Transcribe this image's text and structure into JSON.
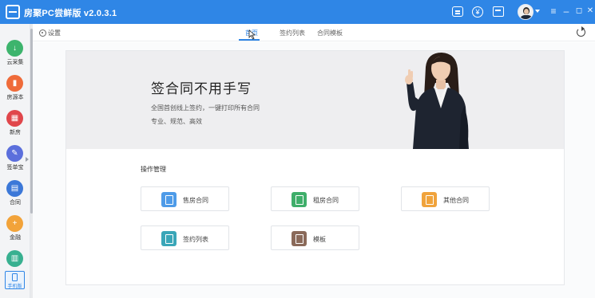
{
  "app": {
    "title": "房聚PC尝鲜版 v2.0.3.1"
  },
  "window_controls": {
    "menu": "≡",
    "minimize": "–",
    "maximize": "◻",
    "close": "✕"
  },
  "titlebar_icons": {
    "yen": "¥"
  },
  "sidebar": {
    "items": [
      {
        "label": "云采集",
        "color": "#3db46d",
        "icon": "download-icon",
        "glyph": "↓"
      },
      {
        "label": "房源本",
        "color": "#ef6b3a",
        "icon": "book-icon",
        "glyph": "▮"
      },
      {
        "label": "新房",
        "color": "#e0464b",
        "icon": "building-icon",
        "glyph": "▦"
      },
      {
        "label": "签单宝",
        "color": "#5b6fdc",
        "icon": "pen-icon",
        "glyph": "✎"
      },
      {
        "label": "合同",
        "color": "#3c78d8",
        "icon": "contract-icon",
        "glyph": "▤"
      },
      {
        "label": "金融",
        "color": "#f2a33a",
        "icon": "money-icon",
        "glyph": "+"
      },
      {
        "label": "",
        "color": "#38b090",
        "icon": "chart-icon",
        "glyph": "▥"
      }
    ],
    "mobile_label": "手机版"
  },
  "toolbar": {
    "settings_label": "设置",
    "tabs": [
      {
        "label": "首页",
        "active": true
      },
      {
        "label": "签约列表",
        "active": false
      },
      {
        "label": "合同模板",
        "active": false
      }
    ]
  },
  "banner": {
    "title": "签合同不用手写",
    "subtitle_line1": "全国首创线上签约，一键打印所有合同",
    "subtitle_line2": "专业、规范、高效"
  },
  "operations": {
    "section_title": "操作管理",
    "items": [
      {
        "label": "售房合同",
        "color": "#4e9be8",
        "icon": "sale-contract-icon"
      },
      {
        "label": "租房合同",
        "color": "#3fae6a",
        "icon": "rent-contract-icon"
      },
      {
        "label": "其他合同",
        "color": "#f0a33c",
        "icon": "other-contract-icon"
      },
      {
        "label": "签约列表",
        "color": "#3aa6b8",
        "icon": "list-icon"
      },
      {
        "label": "模板",
        "color": "#8a6a5a",
        "icon": "template-icon"
      }
    ]
  }
}
